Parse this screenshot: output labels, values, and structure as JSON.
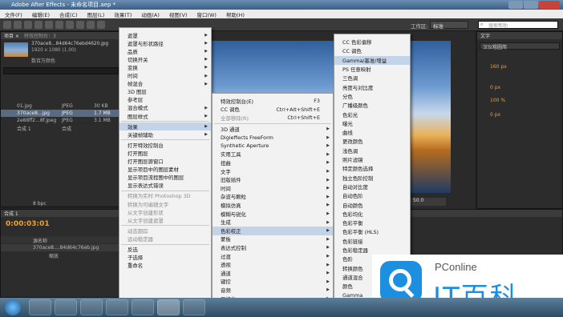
{
  "window": {
    "title": "Adobe After Effects - 未命名项目.aep *"
  },
  "menubar": [
    "文件(F)",
    "编辑(E)",
    "合成(C)",
    "图层(L)",
    "效果(T)",
    "动画(A)",
    "视图(V)",
    "窗口(W)",
    "帮助(H)"
  ],
  "toolbar": {
    "workspace_label": "工作区:",
    "workspace_value": "标准",
    "search_placeholder": "搜索帮助"
  },
  "project_panel": {
    "tab": "项目 ×",
    "effects_tab": "特效控制台：3",
    "item_name": "370ace8...84d64c76ebd4620.jpg",
    "item_dims": "1920 x 1080 (1.00)",
    "item_sub": "数百万颜色",
    "files": [
      {
        "name": "01.jpg",
        "type": "JPEG",
        "size": "30 KB"
      },
      {
        "name": "370ace8...jpg",
        "type": "JPEG",
        "size": "1.7 MB"
      },
      {
        "name": "2e88ff2...8f.jpeg",
        "type": "JPEG",
        "size": "3.1 MB"
      },
      {
        "name": "合成 1",
        "type": "合成",
        "size": ""
      }
    ],
    "bpc": "8 bpc"
  },
  "timeline": {
    "tab": "合成 1",
    "timecode": "0:00:03:01",
    "col_source": "源名称",
    "layer": "370ace8....84d64c76eb.jpg",
    "sub": "缩放"
  },
  "context_menu": {
    "items": [
      {
        "label": "遮罩",
        "arrow": true
      },
      {
        "label": "遮罩与形状路径",
        "arrow": true
      },
      {
        "label": "品质",
        "arrow": true
      },
      {
        "label": "切换开关",
        "arrow": true
      },
      {
        "label": "变换",
        "arrow": true
      },
      {
        "label": "时间",
        "arrow": true
      },
      {
        "label": "帧混合",
        "arrow": true
      },
      {
        "label": "3D 图层",
        "arrow": false
      },
      {
        "label": "参考层",
        "arrow": false
      },
      {
        "label": "混合模式",
        "arrow": true
      },
      {
        "label": "图层样式",
        "arrow": true
      },
      {
        "sep": true
      },
      {
        "label": "效果",
        "arrow": true,
        "hl": true
      },
      {
        "label": "关键帧辅助",
        "arrow": true
      },
      {
        "sep": true
      },
      {
        "label": "打开特效控制台"
      },
      {
        "label": "打开图层"
      },
      {
        "label": "打开图层源窗口"
      },
      {
        "label": "显示项目中的图层素材"
      },
      {
        "label": "显示项目流程图中的图层"
      },
      {
        "label": "显示表达式错误"
      },
      {
        "sep": true
      },
      {
        "label": "转换为实时 Photoshop 3D",
        "dis": true
      },
      {
        "label": "转换为可编辑文字",
        "dis": true
      },
      {
        "label": "从文字创建形状",
        "dis": true
      },
      {
        "label": "从文字创建遮罩",
        "dis": true
      },
      {
        "sep": true
      },
      {
        "label": "动态跟踪",
        "dis": true
      },
      {
        "label": "运动稳定器",
        "dis": true
      },
      {
        "sep": true
      },
      {
        "label": "反选"
      },
      {
        "label": "子选择"
      },
      {
        "label": "重命名"
      }
    ]
  },
  "effects_menu": {
    "items": [
      {
        "label": "特效控制台(E)",
        "sc": "F3"
      },
      {
        "label": "CC 调色",
        "sc": "Ctrl+Alt+Shift+E"
      },
      {
        "label": "全部移除(R)",
        "sc": "Ctrl+Shift+E",
        "dis": true
      },
      {
        "sep": true
      },
      {
        "label": "3D 通道",
        "arrow": true
      },
      {
        "label": "Digieffects FreeForm",
        "arrow": true
      },
      {
        "label": "Synthetic Aperture",
        "arrow": true
      },
      {
        "label": "实用工具",
        "arrow": true
      },
      {
        "label": "扭曲",
        "arrow": true
      },
      {
        "label": "文字",
        "arrow": true
      },
      {
        "label": "旧版插件",
        "arrow": true
      },
      {
        "label": "时间",
        "arrow": true
      },
      {
        "label": "杂波与颗粒",
        "arrow": true
      },
      {
        "label": "模拟仿真",
        "arrow": true
      },
      {
        "label": "模糊与锐化",
        "arrow": true
      },
      {
        "label": "生成",
        "arrow": true
      },
      {
        "label": "色彩校正",
        "arrow": true,
        "hl": true
      },
      {
        "label": "蒙板",
        "arrow": true
      },
      {
        "label": "表达式控制",
        "arrow": true
      },
      {
        "label": "过渡",
        "arrow": true
      },
      {
        "label": "透视",
        "arrow": true
      },
      {
        "label": "通道",
        "arrow": true
      },
      {
        "label": "键控",
        "arrow": true
      },
      {
        "label": "音频",
        "arrow": true
      },
      {
        "label": "风格化",
        "arrow": true
      }
    ]
  },
  "color_menu": {
    "items": [
      "CC 色彩偏移",
      "CC 调色",
      "Gamma/基准/增益",
      "PS 任意映射",
      "三色调",
      "亮度与对比度",
      "分色",
      "广播级颜色",
      "色彩光",
      "曝光",
      "曲线",
      "更改颜色",
      "浅色调",
      "照片滤镜",
      "特定颜色选择",
      "独立色阶控制",
      "自动对比度",
      "自动色阶",
      "自动颜色",
      "色彩均化",
      "色彩平衡",
      "色彩平衡 (HLS)",
      "色彩链接",
      "色彩稳定器",
      "色阶",
      "转换颜色",
      "通道混合",
      "颜色",
      "Gamma"
    ],
    "highlight_index": 2
  },
  "right_panel": {
    "tab": "文字",
    "font": "汉仪粗圆简",
    "size": "160 px",
    "track": "0 px",
    "scale": "100 %",
    "baseline": "0 px",
    "zoom": "50.0"
  },
  "watermark": {
    "brand": "PConline",
    "text": "IT百科"
  },
  "colors": {
    "accent": "#f0a32b",
    "menu_bg": "#f2f2f2",
    "hl": "#c3d3e8",
    "panel": "#2c2c2c"
  }
}
